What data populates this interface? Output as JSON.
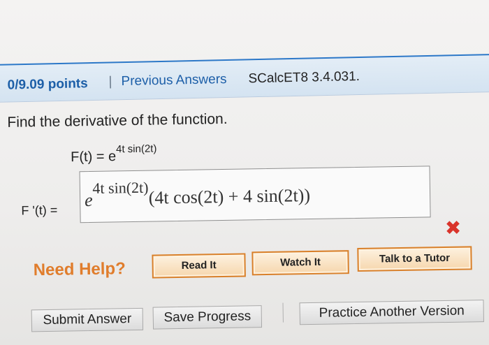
{
  "header": {
    "points": "0/9.09 points",
    "separator": "|",
    "previous_answers": "Previous Answers",
    "problem_code": "SCalcET8 3.4.031."
  },
  "question": {
    "prompt": "Find the derivative of the function.",
    "function_lhs": "F(t) = e",
    "function_exponent": "4t sin(2t)"
  },
  "answer": {
    "label": "F '(t) =",
    "base": "e",
    "exponent": "4t sin(2t)",
    "factor": "(4t cos(2t) + 4 sin(2t))",
    "status": "incorrect",
    "status_mark": "✖"
  },
  "help": {
    "label": "Need Help?",
    "read_it": "Read It",
    "watch_it": "Watch It",
    "talk_to_tutor": "Talk to a Tutor"
  },
  "actions": {
    "submit": "Submit Answer",
    "save": "Save Progress",
    "practice": "Practice Another Version"
  },
  "colors": {
    "link_blue": "#1d5fa8",
    "accent_orange": "#e07d2c",
    "error_red": "#d9342b"
  }
}
